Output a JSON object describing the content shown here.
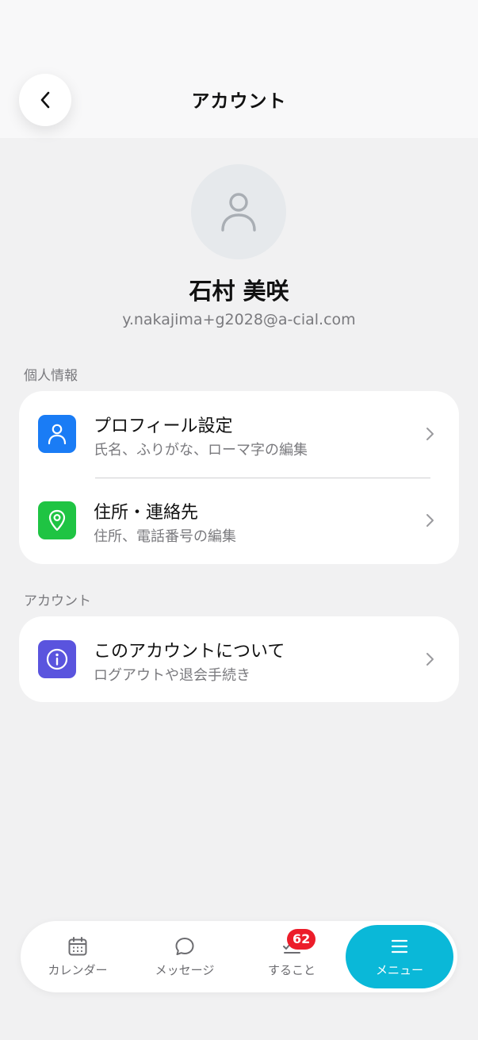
{
  "header": {
    "title": "アカウント"
  },
  "profile": {
    "name": "石村 美咲",
    "email": "y.nakajima+g2028@a-cial.com"
  },
  "sections": [
    {
      "label": "個人情報",
      "items": [
        {
          "title": "プロフィール設定",
          "subtitle": "氏名、ふりがな、ローマ字の編集",
          "icon": "person-icon",
          "color": "#1a7cf5"
        },
        {
          "title": "住所・連絡先",
          "subtitle": "住所、電話番号の編集",
          "icon": "location-pin-icon",
          "color": "#1fc443"
        }
      ]
    },
    {
      "label": "アカウント",
      "items": [
        {
          "title": "このアカウントについて",
          "subtitle": "ログアウトや退会手続き",
          "icon": "info-icon",
          "color": "#5a54de"
        }
      ]
    }
  ],
  "bottom_nav": {
    "items": [
      {
        "label": "カレンダー",
        "icon": "calendar-icon"
      },
      {
        "label": "メッセージ",
        "icon": "chat-bubble-icon"
      },
      {
        "label": "すること",
        "icon": "checklist-icon",
        "badge": "62"
      },
      {
        "label": "メニュー",
        "icon": "menu-icon",
        "active": true
      }
    ]
  },
  "colors": {
    "accent": "#0ab8d8",
    "badge": "#ec1d2a",
    "background": "#f1f1f2"
  }
}
